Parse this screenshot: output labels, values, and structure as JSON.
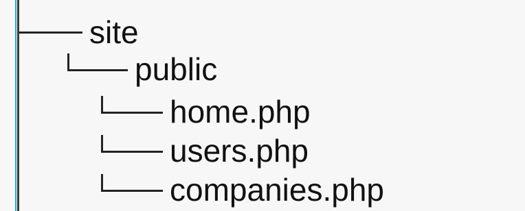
{
  "tree": {
    "items": [
      {
        "label": "site",
        "level": 0
      },
      {
        "label": "public",
        "level": 1
      },
      {
        "label": "home.php",
        "level": 2
      },
      {
        "label": "users.php",
        "level": 2
      },
      {
        "label": "companies.php",
        "level": 2
      }
    ]
  }
}
